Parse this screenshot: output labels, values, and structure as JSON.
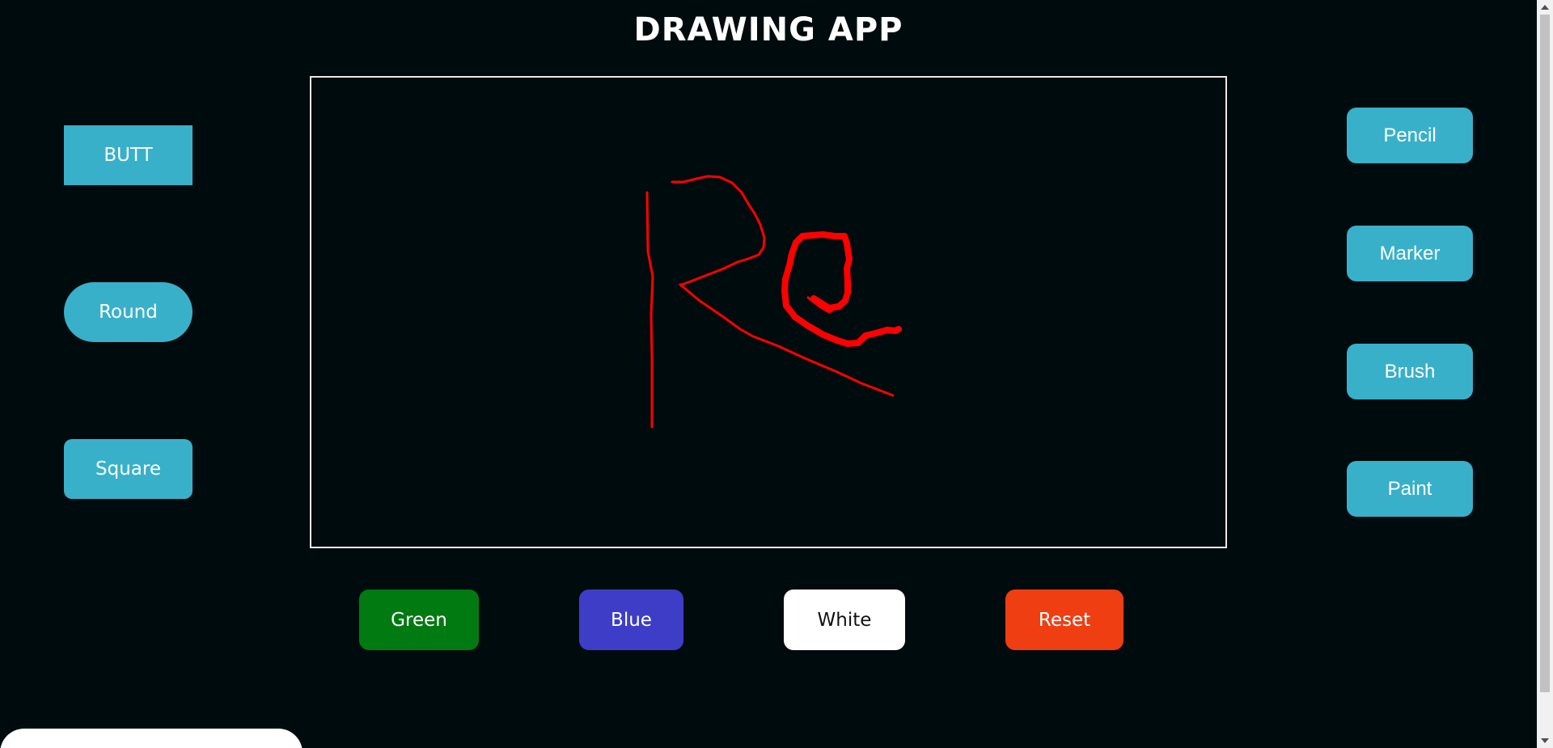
{
  "app": {
    "title": "DRAWING APP"
  },
  "line_cap_buttons": [
    {
      "label": "BUTT"
    },
    {
      "label": "Round"
    },
    {
      "label": "Square"
    }
  ],
  "tool_buttons": [
    {
      "label": "Pencil"
    },
    {
      "label": "Marker"
    },
    {
      "label": "Brush"
    },
    {
      "label": "Paint"
    }
  ],
  "color_buttons": [
    {
      "label": "Green",
      "color": "#017a12"
    },
    {
      "label": "Blue",
      "color": "#3d3dc8"
    },
    {
      "label": "White",
      "color": "#ffffff"
    }
  ],
  "reset_button": {
    "label": "Reset",
    "color": "#ef3e12"
  },
  "colors": {
    "background": "#000b0d",
    "accent": "#38b0c9",
    "stroke": "#ff0000",
    "canvas_border": "#e8e8e8"
  }
}
